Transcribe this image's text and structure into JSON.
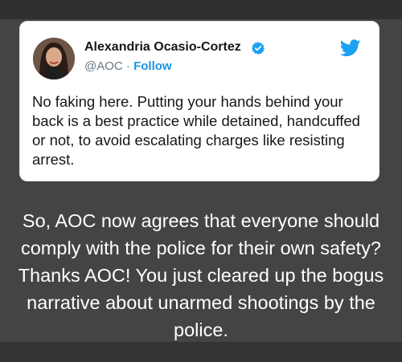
{
  "tweet": {
    "author_name": "Alexandria Ocasio-Cortez",
    "handle": "@AOC",
    "separator": " · ",
    "follow_label": "Follow",
    "text": "No faking here. Putting your hands behind your back is a best practice while detained, handcuffed or not, to avoid escalating charges like resisting arrest.",
    "icons": {
      "verified": "verified-badge-icon",
      "platform": "twitter-bird-icon"
    },
    "colors": {
      "accent": "#1da1f2",
      "follow": "#1b95e0",
      "name": "#14171a",
      "handle": "#657786"
    }
  },
  "caption": {
    "text": "So, AOC now agrees that everyone should comply with the police for their own safety? Thanks AOC! You just cleared up the bogus narrative about unarmed shootings by the police."
  },
  "colors": {
    "background": "#444444",
    "caption_text": "#ffffff"
  }
}
